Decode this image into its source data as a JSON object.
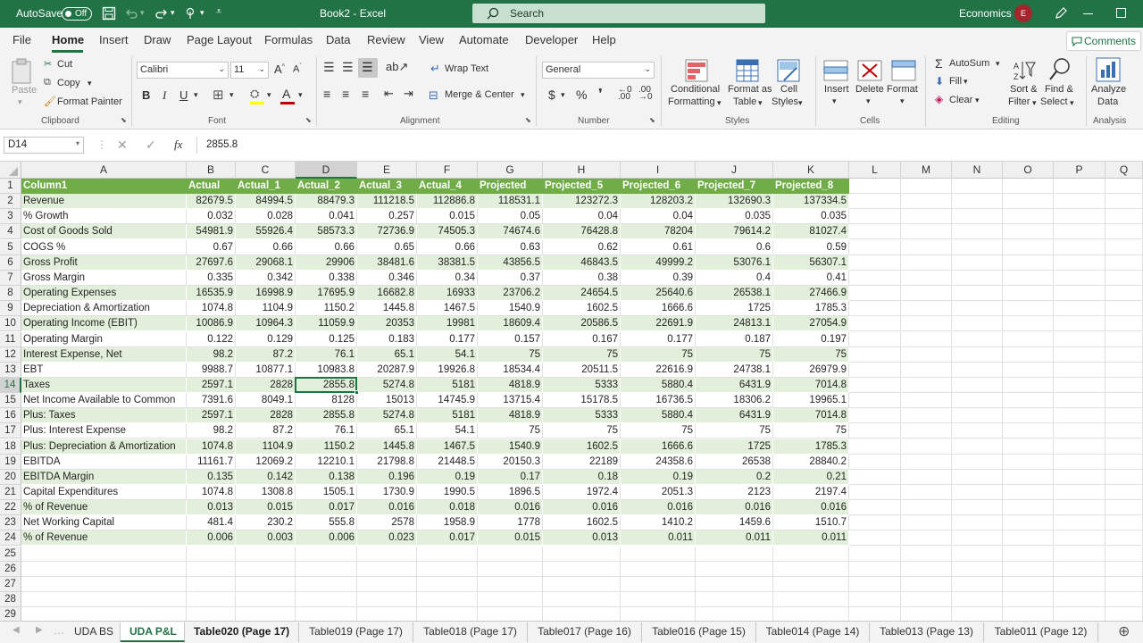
{
  "titlebar": {
    "autosave_label": "AutoSave",
    "autosave_state": "Off",
    "doc_title": "Book2  -  Excel",
    "search_placeholder": "Search",
    "account_name": "Economics",
    "account_initial": "E"
  },
  "ribbon_tabs": [
    "File",
    "Home",
    "Insert",
    "Draw",
    "Page Layout",
    "Formulas",
    "Data",
    "Review",
    "View",
    "Automate",
    "Developer",
    "Help"
  ],
  "comments_label": "Comments",
  "ribbon": {
    "clipboard": {
      "paste": "Paste",
      "cut": "Cut",
      "copy": "Copy",
      "format_painter": "Format Painter",
      "group": "Clipboard"
    },
    "font": {
      "name": "Calibri",
      "size": "11",
      "group": "Font"
    },
    "alignment": {
      "wrap": "Wrap Text",
      "merge": "Merge & Center",
      "group": "Alignment"
    },
    "number": {
      "format": "General",
      "group": "Number"
    },
    "styles": {
      "conditional": "Conditional",
      "conditional2": "Formatting",
      "format_as": "Format as",
      "format_as2": "Table",
      "cell_styles": "Cell",
      "cell_styles2": "Styles",
      "group": "Styles"
    },
    "cells": {
      "insert": "Insert",
      "delete": "Delete",
      "format": "Format",
      "group": "Cells"
    },
    "editing": {
      "autosum": "AutoSum",
      "fill": "Fill",
      "clear": "Clear",
      "sort": "Sort &",
      "sort2": "Filter",
      "find": "Find &",
      "find2": "Select",
      "group": "Editing"
    },
    "analysis": {
      "analyze": "Analyze",
      "analyze2": "Data",
      "group": "Analysis"
    }
  },
  "formula": {
    "name_box": "D14",
    "fx": "fx",
    "value": "2855.8"
  },
  "columns": [
    "A",
    "B",
    "C",
    "D",
    "E",
    "F",
    "G",
    "H",
    "I",
    "J",
    "K",
    "L",
    "M",
    "N",
    "O",
    "P",
    "Q"
  ],
  "header_row": [
    "Column1",
    "Actual",
    "Actual_1",
    "Actual_2",
    "Actual_3",
    "Actual_4",
    "Projected",
    "Projected_5",
    "Projected_6",
    "Projected_7",
    "Projected_8"
  ],
  "rows": [
    [
      "Revenue",
      "82679.5",
      "84994.5",
      "88479.3",
      "111218.5",
      "112886.8",
      "118531.1",
      "123272.3",
      "128203.2",
      "132690.3",
      "137334.5"
    ],
    [
      "% Growth",
      "0.032",
      "0.028",
      "0.041",
      "0.257",
      "0.015",
      "0.05",
      "0.04",
      "0.04",
      "0.035",
      "0.035"
    ],
    [
      "Cost of Goods Sold",
      "54981.9",
      "55926.4",
      "58573.3",
      "72736.9",
      "74505.3",
      "74674.6",
      "76428.8",
      "78204",
      "79614.2",
      "81027.4"
    ],
    [
      "COGS %",
      "0.67",
      "0.66",
      "0.66",
      "0.65",
      "0.66",
      "0.63",
      "0.62",
      "0.61",
      "0.6",
      "0.59"
    ],
    [
      "Gross Profit",
      "27697.6",
      "29068.1",
      "29906",
      "38481.6",
      "38381.5",
      "43856.5",
      "46843.5",
      "49999.2",
      "53076.1",
      "56307.1"
    ],
    [
      "Gross Margin",
      "0.335",
      "0.342",
      "0.338",
      "0.346",
      "0.34",
      "0.37",
      "0.38",
      "0.39",
      "0.4",
      "0.41"
    ],
    [
      "Operating Expenses",
      "16535.9",
      "16998.9",
      "17695.9",
      "16682.8",
      "16933",
      "23706.2",
      "24654.5",
      "25640.6",
      "26538.1",
      "27466.9"
    ],
    [
      "Depreciation & Amortization",
      "1074.8",
      "1104.9",
      "1150.2",
      "1445.8",
      "1467.5",
      "1540.9",
      "1602.5",
      "1666.6",
      "1725",
      "1785.3"
    ],
    [
      "Operating Income (EBIT)",
      "10086.9",
      "10964.3",
      "11059.9",
      "20353",
      "19981",
      "18609.4",
      "20586.5",
      "22691.9",
      "24813.1",
      "27054.9"
    ],
    [
      "Operating Margin",
      "0.122",
      "0.129",
      "0.125",
      "0.183",
      "0.177",
      "0.157",
      "0.167",
      "0.177",
      "0.187",
      "0.197"
    ],
    [
      "Interest Expense, Net",
      "98.2",
      "87.2",
      "76.1",
      "65.1",
      "54.1",
      "75",
      "75",
      "75",
      "75",
      "75"
    ],
    [
      "EBT",
      "9988.7",
      "10877.1",
      "10983.8",
      "20287.9",
      "19926.8",
      "18534.4",
      "20511.5",
      "22616.9",
      "24738.1",
      "26979.9"
    ],
    [
      "Taxes",
      "2597.1",
      "2828",
      "2855.8",
      "5274.8",
      "5181",
      "4818.9",
      "5333",
      "5880.4",
      "6431.9",
      "7014.8"
    ],
    [
      "Net Income Available to Common",
      "7391.6",
      "8049.1",
      "8128",
      "15013",
      "14745.9",
      "13715.4",
      "15178.5",
      "16736.5",
      "18306.2",
      "19965.1"
    ],
    [
      "Plus: Taxes",
      "2597.1",
      "2828",
      "2855.8",
      "5274.8",
      "5181",
      "4818.9",
      "5333",
      "5880.4",
      "6431.9",
      "7014.8"
    ],
    [
      "Plus: Interest Expense",
      "98.2",
      "87.2",
      "76.1",
      "65.1",
      "54.1",
      "75",
      "75",
      "75",
      "75",
      "75"
    ],
    [
      "Plus: Depreciation & Amortization",
      "1074.8",
      "1104.9",
      "1150.2",
      "1445.8",
      "1467.5",
      "1540.9",
      "1602.5",
      "1666.6",
      "1725",
      "1785.3"
    ],
    [
      "EBITDA",
      "11161.7",
      "12069.2",
      "12210.1",
      "21798.8",
      "21448.5",
      "20150.3",
      "22189",
      "24358.6",
      "26538",
      "28840.2"
    ],
    [
      "EBITDA Margin",
      "0.135",
      "0.142",
      "0.138",
      "0.196",
      "0.19",
      "0.17",
      "0.18",
      "0.19",
      "0.2",
      "0.21"
    ],
    [
      "Capital Expenditures",
      "1074.8",
      "1308.8",
      "1505.1",
      "1730.9",
      "1990.5",
      "1896.5",
      "1972.4",
      "2051.3",
      "2123",
      "2197.4"
    ],
    [
      "% of Revenue",
      "0.013",
      "0.015",
      "0.017",
      "0.016",
      "0.018",
      "0.016",
      "0.016",
      "0.016",
      "0.016",
      "0.016"
    ],
    [
      "Net Working Capital",
      "481.4",
      "230.2",
      "555.8",
      "2578",
      "1958.9",
      "1778",
      "1602.5",
      "1410.2",
      "1459.6",
      "1510.7"
    ],
    [
      "% of Revenue",
      "0.006",
      "0.003",
      "0.006",
      "0.023",
      "0.017",
      "0.015",
      "0.013",
      "0.011",
      "0.011",
      "0.011"
    ]
  ],
  "row_numbers": [
    "1",
    "2",
    "3",
    "4",
    "5",
    "6",
    "7",
    "8",
    "9",
    "10",
    "11",
    "12",
    "13",
    "14",
    "15",
    "16",
    "17",
    "18",
    "19",
    "20",
    "21",
    "22",
    "23",
    "24",
    "25",
    "26",
    "27",
    "28",
    "29"
  ],
  "selected_cell": "D14",
  "sheet_tabs": [
    "UDA BS",
    "UDA P&L",
    "Table020 (Page 17)",
    "Table019 (Page 17)",
    "Table018 (Page 17)",
    "Table017 (Page 16)",
    "Table016 (Page 15)",
    "Table014 (Page 14)",
    "Table013 (Page 13)",
    "Table011 (Page 12)"
  ],
  "active_sheet": "UDA P&L",
  "colors": {
    "brand": "#217346",
    "table_header": "#70ad47",
    "band_light": "#e2efda"
  }
}
